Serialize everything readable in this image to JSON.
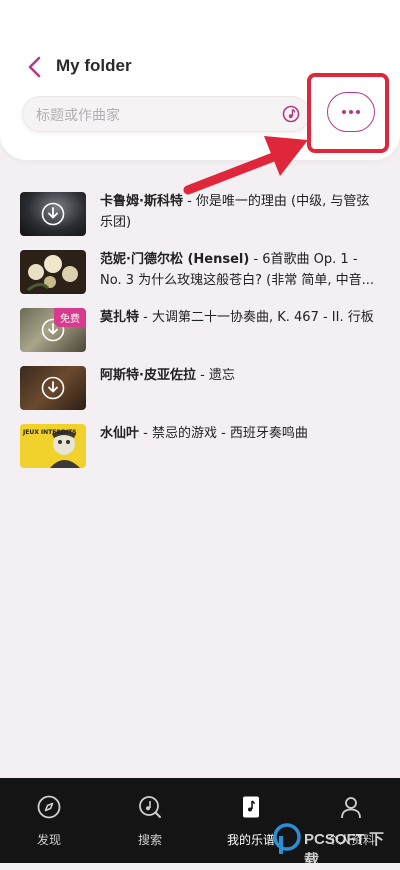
{
  "header": {
    "title": "My folder",
    "search_placeholder": "标题或作曲家"
  },
  "scores": [
    {
      "composer": "卡鲁姆·斯科特",
      "rest": " - 你是唯一的理由 (中级, 与管弦乐团)",
      "thumb": "dark-stage",
      "badge": ""
    },
    {
      "composer": "范妮·门德尔松 (Hensel)",
      "rest": " - 6首歌曲 Op. 1 - No. 3 为什么玫瑰这般苍白? (非常 简单, 中音...",
      "thumb": "flowers",
      "badge": ""
    },
    {
      "composer": "莫扎特",
      "rest": " - 大调第二十一协奏曲, K. 467 - II. 行板",
      "thumb": "painting",
      "badge": "免费"
    },
    {
      "composer": "阿斯特·皮亚佐拉",
      "rest": " - 遗忘",
      "thumb": "dark-brown",
      "badge": ""
    },
    {
      "composer": "水仙叶",
      "rest": " - 禁忌的游戏 - 西班牙奏鸣曲",
      "thumb": "yellow-poster",
      "badge": ""
    }
  ],
  "thumb_text": {
    "poster": "JEUX INTERDITS"
  },
  "tabs": [
    {
      "label": "发现",
      "icon": "compass-icon"
    },
    {
      "label": "搜索",
      "icon": "search-music-icon"
    },
    {
      "label": "我的乐谱",
      "icon": "score-book-icon",
      "active": true
    },
    {
      "label": "个人资料",
      "icon": "profile-icon"
    }
  ],
  "watermark": {
    "text": "PCSOFT 下载"
  },
  "colors": {
    "accent": "#b23a86",
    "highlight": "#e0263a",
    "tabbar": "#141414",
    "badge": "#d83a8e"
  }
}
